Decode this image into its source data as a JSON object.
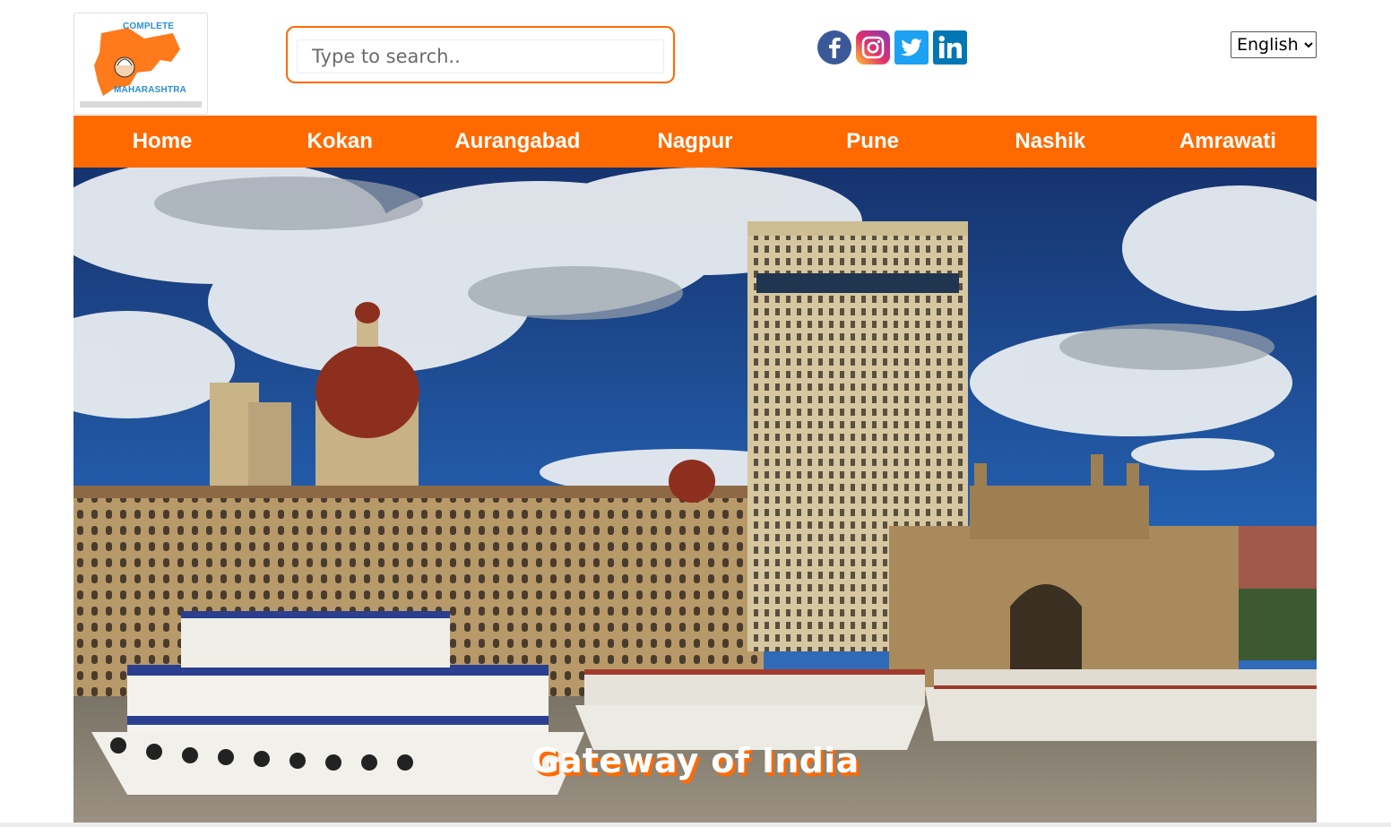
{
  "logo": {
    "line1": "COMPLETE",
    "line2": "MAHARASHTRA",
    "color": "#ff7a1a"
  },
  "search": {
    "placeholder": "Type to search..",
    "value": ""
  },
  "social": [
    "facebook-icon",
    "instagram-icon",
    "twitter-icon",
    "linkedin-icon"
  ],
  "language": {
    "selected": "English"
  },
  "nav": {
    "items": [
      "Home",
      "Kokan",
      "Aurangabad",
      "Nagpur",
      "Pune",
      "Nashik",
      "Amrawati"
    ],
    "background": "#ff6a00"
  },
  "hero": {
    "caption": "Gateway of India"
  },
  "colors": {
    "accent": "#ff6a00",
    "sky": "#1e4f9a"
  }
}
